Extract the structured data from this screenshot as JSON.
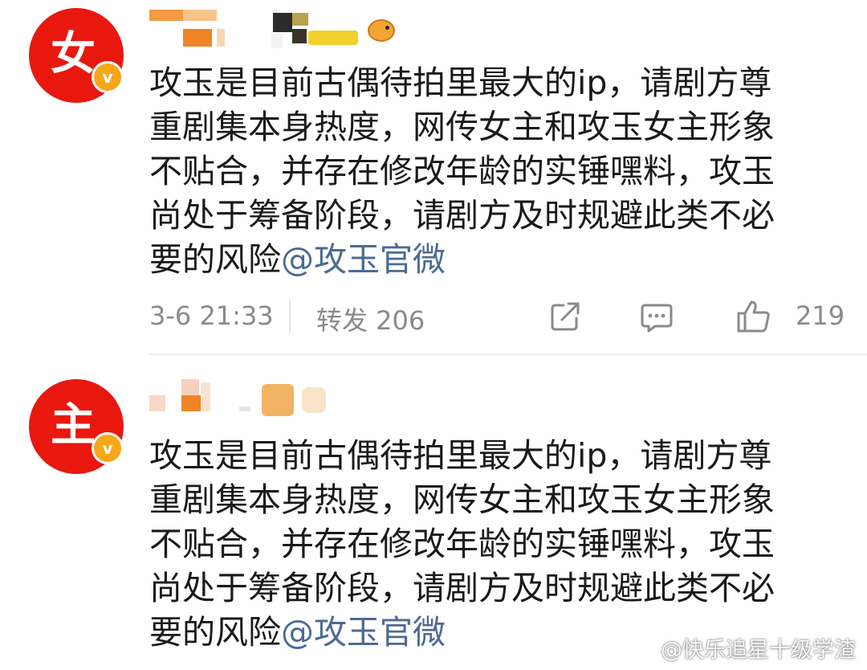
{
  "posts": [
    {
      "avatar_char": "女",
      "content_lines": [
        "攻玉是目前古偶待拍里最大的ip，请剧方尊",
        "重剧集本身热度，网传女主和攻玉女主形象",
        "不贴合，并存在修改年龄的实锤嘿料，攻玉",
        "尚处于筹备阶段，请剧方及时规避此类不必"
      ],
      "content_tail": "要的风险",
      "mention": "@攻玉官微",
      "time": "3-6 21:33",
      "repost": "转发 206",
      "likes": "219"
    },
    {
      "avatar_char": "主",
      "content_lines": [
        "攻玉是目前古偶待拍里最大的ip，请剧方尊",
        "重剧集本身热度，网传女主和攻玉女主形象",
        "不贴合，并存在修改年龄的实锤嘿料，攻玉",
        "尚处于筹备阶段，请剧方及时规避此类不必"
      ],
      "content_tail": "要的风险",
      "mention": "@攻玉官微"
    }
  ],
  "watermark": "@快乐追星十级学渣",
  "colors": {
    "avatar_red": "#e8180f",
    "verified_badge": "#f7a618",
    "mention_blue": "#4c6a93",
    "meta_gray": "#8a8a8a"
  },
  "icons": [
    "verified-badge-icon",
    "share-icon",
    "comment-icon",
    "like-icon",
    "weibo-logo-icon"
  ]
}
